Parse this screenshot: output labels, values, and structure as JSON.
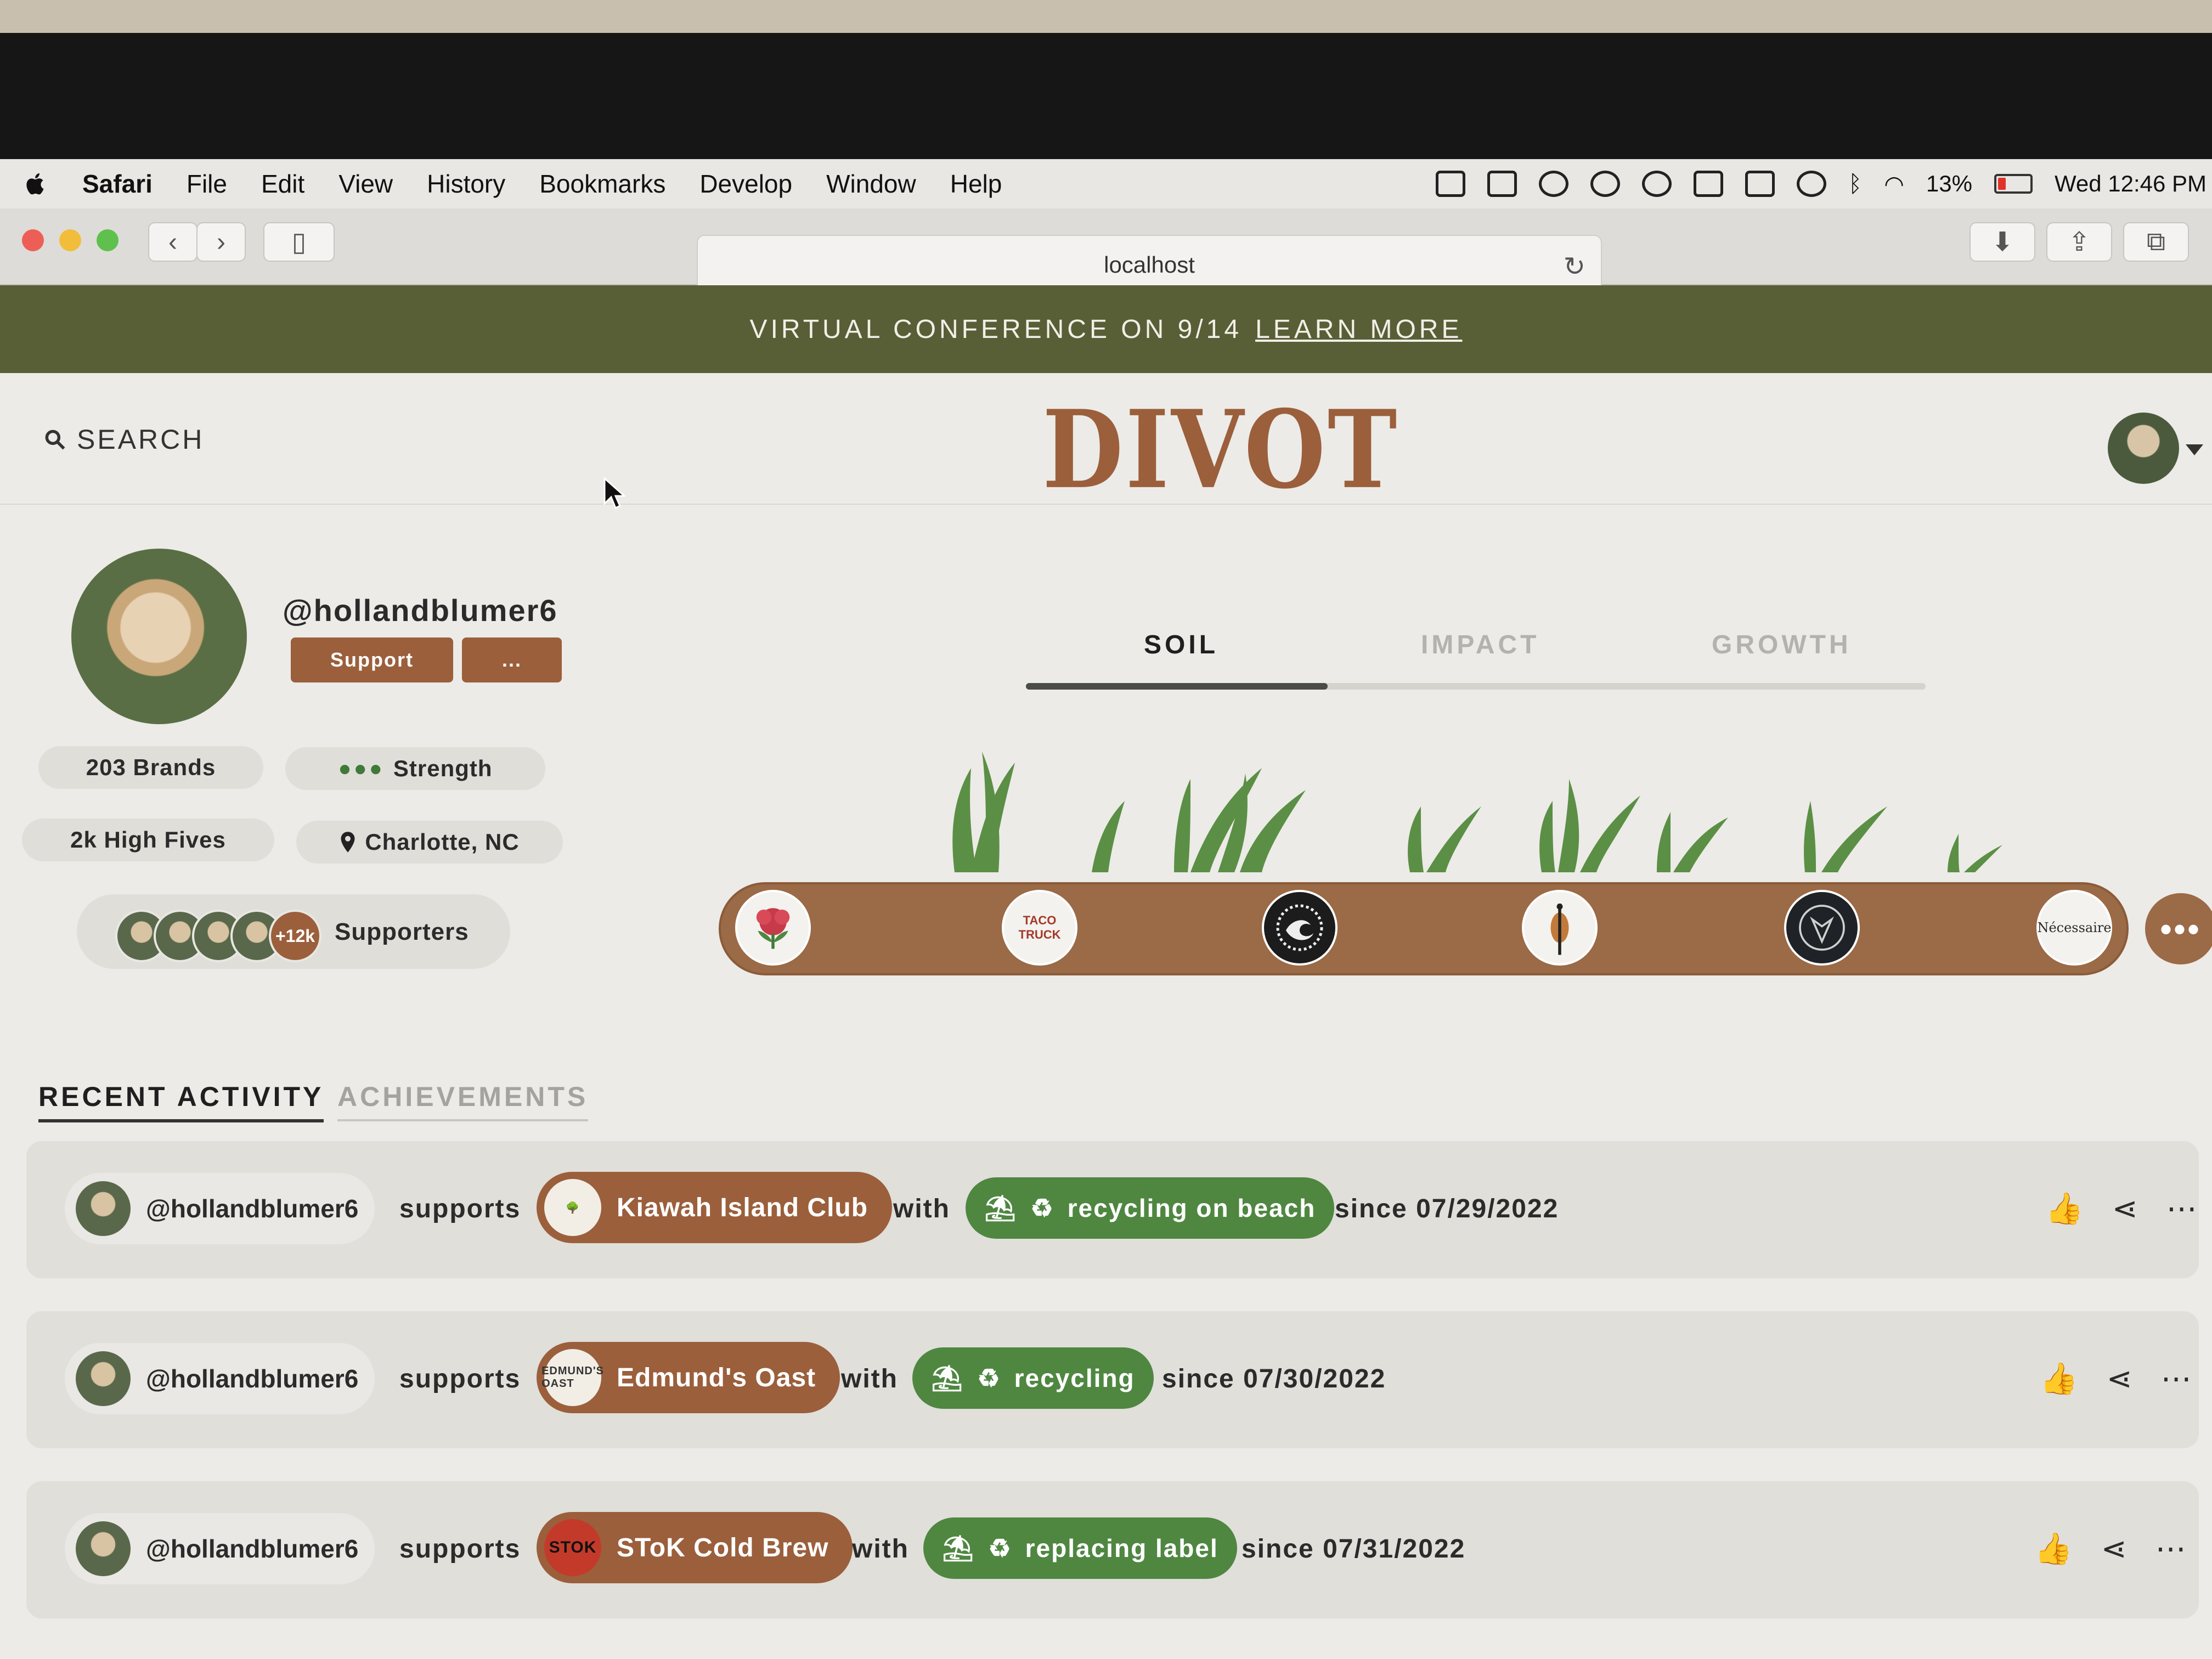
{
  "menubar": {
    "items": [
      "Safari",
      "File",
      "Edit",
      "View",
      "History",
      "Bookmarks",
      "Develop",
      "Window",
      "Help"
    ],
    "battery": "13%",
    "clock": "Wed 12:46 PM"
  },
  "browser": {
    "url": "localhost"
  },
  "banner": {
    "text": "VIRTUAL CONFERENCE ON 9/14",
    "link": "LEARN MORE"
  },
  "header": {
    "search": "SEARCH",
    "logo": "DIVOT"
  },
  "profile": {
    "username": "@hollandblumer6",
    "support_button": "Support",
    "more_button": "...",
    "brands": "203 Brands",
    "strength": "Strength",
    "high_fives": "2k High Fives",
    "location": "Charlotte, NC",
    "supporters_more": "+12k",
    "supporters_label": "Supporters"
  },
  "profile_tabs": [
    "SOIL",
    "IMPACT",
    "GROWTH"
  ],
  "soil_brands": [
    "rose-logo",
    "TACO TRUCK",
    "wave-logo",
    "figure-logo",
    "crest-logo",
    "Nécessaire"
  ],
  "activity_tabs": [
    "RECENT ACTIVITY",
    "ACHIEVEMENTS"
  ],
  "activity": [
    {
      "user": "@hollandblumer6",
      "verb": "supports",
      "brand": "Kiawah Island Club",
      "with": "with",
      "impact": "recycling on beach",
      "since": "since 07/29/2022"
    },
    {
      "user": "@hollandblumer6",
      "verb": "supports",
      "brand": "Edmund's Oast",
      "with": "with",
      "impact": "recycling",
      "since": "since 07/30/2022"
    },
    {
      "user": "@hollandblumer6",
      "verb": "supports",
      "brand": "SToK Cold Brew",
      "with": "with",
      "impact": "replacing label",
      "since": "since 07/31/2022"
    }
  ],
  "brand_logo_text": {
    "edmunds": "EDMUND'S OAST",
    "stok": "STOK"
  },
  "colors": {
    "brown": "#9b5f3c",
    "green": "#4f8741",
    "banner": "#585f37",
    "background": "#ecebe7"
  }
}
